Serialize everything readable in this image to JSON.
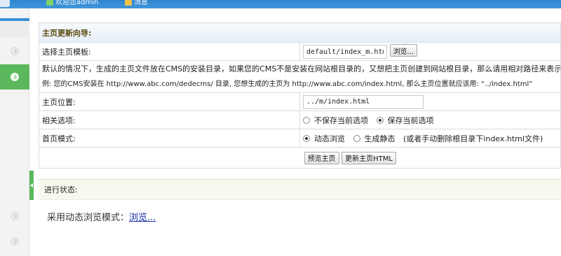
{
  "topbar": {
    "item1_label": "欢迎您admin",
    "item2_label": "消息",
    "accent": "#3a8fd6"
  },
  "sidebar": {
    "accent": "#5cb85c",
    "items": [
      {
        "icon": "chevron-right-icon",
        "active": false
      },
      {
        "icon": "chevron-right-icon",
        "active": true
      },
      {
        "icon": "chevron-right-icon",
        "active": false
      },
      {
        "icon": "chevron-right-icon",
        "active": false
      }
    ],
    "toggle_icon": "chevron-left-icon"
  },
  "panel": {
    "title": "主页更新向导:",
    "template_label": "选择主页模板:",
    "template_value": "default/index_m.htm",
    "browse_button": "浏览...",
    "help_line1": "默认的情况下，生成的主页文件放在CMS的安装目录，如果您的CMS不是安装在网站根目录的，又想把主页创建到网站根目录，那么请用相对路径来表示“主页位置”",
    "help_line2": "例: 您的CMS安装在 http://www.abc.com/dedecms/ 目录, 您想生成的主页为 http://www.abc.com/index.html, 那么主页位置就应该用: “../index.html”",
    "position_label": "主页位置:",
    "position_value": "../m/index.html",
    "options_label": "相关选项:",
    "option_no_save": "不保存当前选项",
    "option_save": "保存当前选项",
    "mode_label": "首页模式:",
    "mode_dynamic": "动态浏览",
    "mode_static": "生成静态",
    "mode_static_note": "(或者手动删除根目录下index.html文件)",
    "preview_button": "预览主页",
    "update_button": "更新主页HTML"
  },
  "status": {
    "header": "进行状态:",
    "message": "采用动态浏览模式：",
    "link": "浏览..."
  }
}
